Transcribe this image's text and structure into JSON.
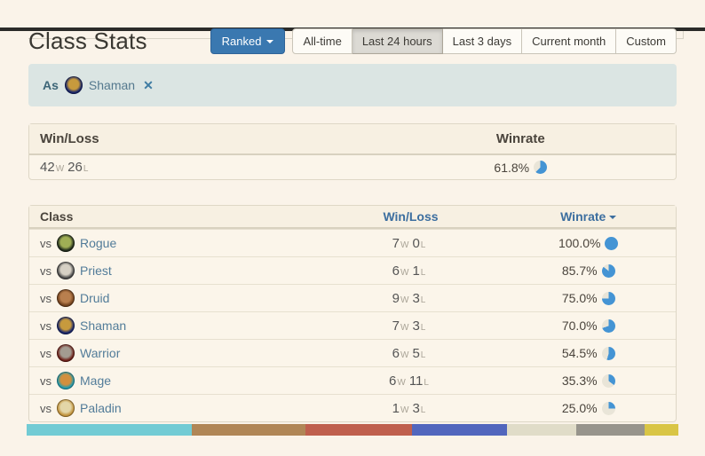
{
  "page": {
    "title": "Class Stats"
  },
  "controls": {
    "mode_button": {
      "label": "Ranked"
    },
    "time_tabs": [
      {
        "label": "All-time",
        "selected": false
      },
      {
        "label": "Last 24 hours",
        "selected": true
      },
      {
        "label": "Last 3 days",
        "selected": false
      },
      {
        "label": "Current month",
        "selected": false
      },
      {
        "label": "Custom",
        "selected": false
      }
    ]
  },
  "filter_chip": {
    "prefix": "As",
    "class": "Shaman",
    "remove_icon": "✕",
    "icon": {
      "ring": "#16246b",
      "center": "#c79a3d"
    }
  },
  "labels": {
    "vs": "vs",
    "win_suffix": "W",
    "loss_suffix": "L"
  },
  "summary_table": {
    "headers": {
      "winloss": "Win/Loss",
      "winrate": "Winrate"
    },
    "wins": "42",
    "losses": "26",
    "winrate": "61.8%",
    "winrate_pct": 61.8
  },
  "class_table": {
    "headers": {
      "class": "Class",
      "winloss": "Win/Loss",
      "winrate": "Winrate"
    },
    "rows": [
      {
        "class": "Rogue",
        "wins": "7",
        "losses": "0",
        "winrate": "100.0%",
        "winrate_pct": 100,
        "icon": {
          "ring": "#222c1c",
          "center": "#9fae55"
        }
      },
      {
        "class": "Priest",
        "wins": "6",
        "losses": "1",
        "winrate": "85.7%",
        "winrate_pct": 85.7,
        "icon": {
          "ring": "#4a4a4a",
          "center": "#d6d0c4"
        }
      },
      {
        "class": "Druid",
        "wins": "9",
        "losses": "3",
        "winrate": "75.0%",
        "winrate_pct": 75,
        "icon": {
          "ring": "#71411d",
          "center": "#b97f4e"
        }
      },
      {
        "class": "Shaman",
        "wins": "7",
        "losses": "3",
        "winrate": "70.0%",
        "winrate_pct": 70,
        "icon": {
          "ring": "#16246b",
          "center": "#c79a3d"
        }
      },
      {
        "class": "Warrior",
        "wins": "6",
        "losses": "5",
        "winrate": "54.5%",
        "winrate_pct": 54.5,
        "icon": {
          "ring": "#6e211a",
          "center": "#a39b91"
        }
      },
      {
        "class": "Mage",
        "wins": "6",
        "losses": "11",
        "winrate": "35.3%",
        "winrate_pct": 35.3,
        "icon": {
          "ring": "#1f9bb0",
          "center": "#d28f3e"
        }
      },
      {
        "class": "Paladin",
        "wins": "1",
        "losses": "3",
        "winrate": "25.0%",
        "winrate_pct": 25,
        "icon": {
          "ring": "#c0913a",
          "center": "#e3d6a8"
        }
      }
    ]
  },
  "distribution": {
    "segments": [
      {
        "color": "#72cbd4",
        "width_pct": 25.4
      },
      {
        "color": "#b08656",
        "width_pct": 17.4
      },
      {
        "color": "#bf5f4d",
        "width_pct": 16.3
      },
      {
        "color": "#5166bd",
        "width_pct": 14.6
      },
      {
        "color": "#e0dcc8",
        "width_pct": 10.6
      },
      {
        "color": "#97948c",
        "width_pct": 10.5
      },
      {
        "color": "#d9c545",
        "width_pct": 5.2
      }
    ]
  },
  "colors": {
    "pie_fill": "#4494d4",
    "pie_rest": "#e9e5d8",
    "accent_button": "#3a78b0",
    "page_bg": "#faf3e9",
    "chip_bg": "#dbe5e3"
  }
}
